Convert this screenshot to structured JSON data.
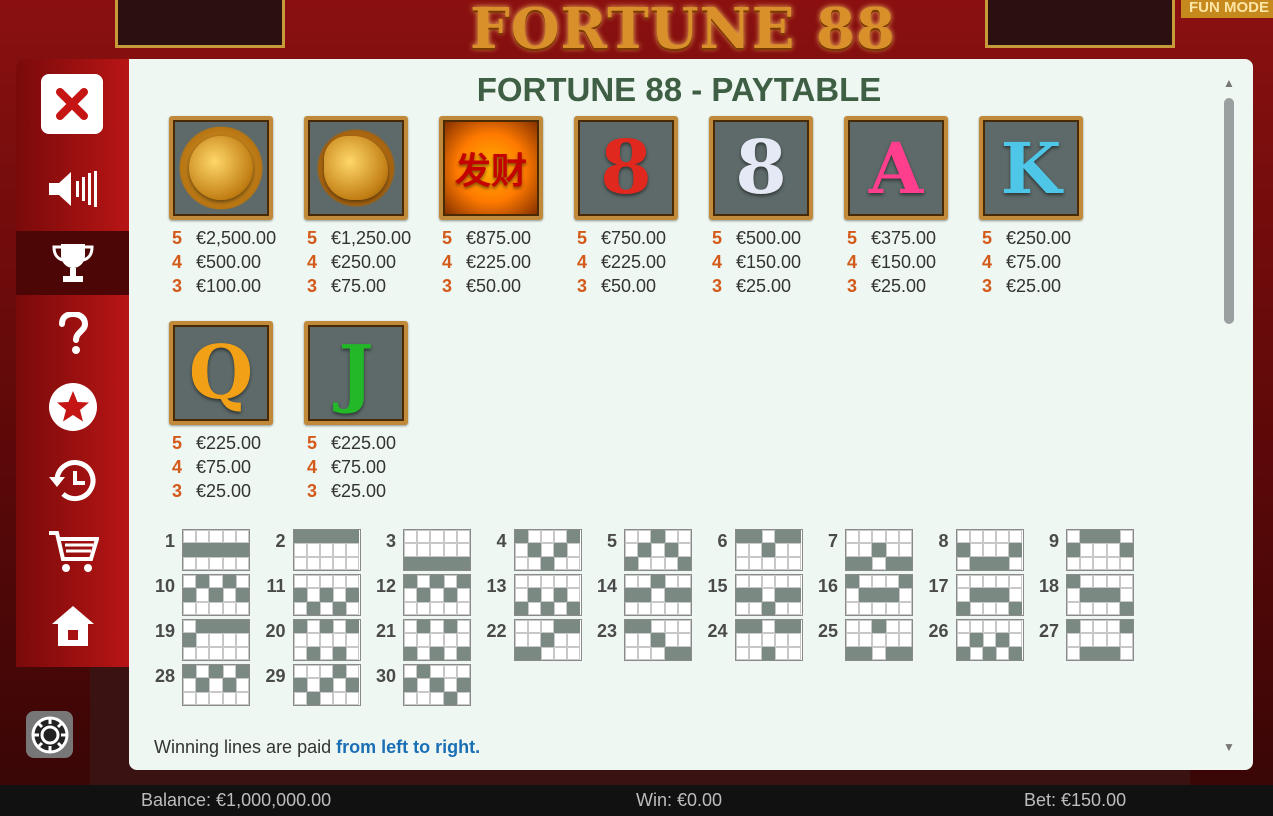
{
  "background": {
    "logo_text": "FORTUNE 88",
    "fun_mode": "FUN MODE"
  },
  "sidebar": {
    "icons": [
      "close-icon",
      "sound-icon",
      "trophy-icon",
      "help-icon",
      "star-icon",
      "history-icon",
      "cart-icon",
      "home-icon",
      "settings-chip-icon"
    ]
  },
  "paytable": {
    "title": "FORTUNE 88 - PAYTABLE",
    "symbols": [
      {
        "id": "lion",
        "pays": [
          {
            "m": "5",
            "v": "€2,500.00"
          },
          {
            "m": "4",
            "v": "€500.00"
          },
          {
            "m": "3",
            "v": "€100.00"
          }
        ]
      },
      {
        "id": "dragon",
        "pays": [
          {
            "m": "5",
            "v": "€1,250.00"
          },
          {
            "m": "4",
            "v": "€250.00"
          },
          {
            "m": "3",
            "v": "€75.00"
          }
        ]
      },
      {
        "id": "coin",
        "glyph": "发财",
        "pays": [
          {
            "m": "5",
            "v": "€875.00"
          },
          {
            "m": "4",
            "v": "€225.00"
          },
          {
            "m": "3",
            "v": "€50.00"
          }
        ]
      },
      {
        "id": "red-8",
        "glyph": "8",
        "pays": [
          {
            "m": "5",
            "v": "€750.00"
          },
          {
            "m": "4",
            "v": "€225.00"
          },
          {
            "m": "3",
            "v": "€50.00"
          }
        ]
      },
      {
        "id": "silver-8",
        "glyph": "8",
        "pays": [
          {
            "m": "5",
            "v": "€500.00"
          },
          {
            "m": "4",
            "v": "€150.00"
          },
          {
            "m": "3",
            "v": "€25.00"
          }
        ]
      },
      {
        "id": "a",
        "glyph": "A",
        "pays": [
          {
            "m": "5",
            "v": "€375.00"
          },
          {
            "m": "4",
            "v": "€150.00"
          },
          {
            "m": "3",
            "v": "€25.00"
          }
        ]
      },
      {
        "id": "k",
        "glyph": "K",
        "pays": [
          {
            "m": "5",
            "v": "€250.00"
          },
          {
            "m": "4",
            "v": "€75.00"
          },
          {
            "m": "3",
            "v": "€25.00"
          }
        ]
      },
      {
        "id": "q",
        "glyph": "Q",
        "pays": [
          {
            "m": "5",
            "v": "€225.00"
          },
          {
            "m": "4",
            "v": "€75.00"
          },
          {
            "m": "3",
            "v": "€25.00"
          }
        ]
      },
      {
        "id": "j",
        "glyph": "J",
        "pays": [
          {
            "m": "5",
            "v": "€225.00"
          },
          {
            "m": "4",
            "v": "€75.00"
          },
          {
            "m": "3",
            "v": "€25.00"
          }
        ]
      }
    ],
    "paylines": [
      {
        "n": "1",
        "rows": [
          1,
          1,
          1,
          1,
          1
        ]
      },
      {
        "n": "2",
        "rows": [
          0,
          0,
          0,
          0,
          0
        ]
      },
      {
        "n": "3",
        "rows": [
          2,
          2,
          2,
          2,
          2
        ]
      },
      {
        "n": "4",
        "rows": [
          0,
          1,
          2,
          1,
          0
        ]
      },
      {
        "n": "5",
        "rows": [
          2,
          1,
          0,
          1,
          2
        ]
      },
      {
        "n": "6",
        "rows": [
          0,
          0,
          1,
          0,
          0
        ]
      },
      {
        "n": "7",
        "rows": [
          2,
          2,
          1,
          2,
          2
        ]
      },
      {
        "n": "8",
        "rows": [
          1,
          2,
          2,
          2,
          1
        ]
      },
      {
        "n": "9",
        "rows": [
          1,
          0,
          0,
          0,
          1
        ]
      },
      {
        "n": "10",
        "rows": [
          1,
          0,
          1,
          0,
          1
        ]
      },
      {
        "n": "11",
        "rows": [
          1,
          2,
          1,
          2,
          1
        ]
      },
      {
        "n": "12",
        "rows": [
          0,
          1,
          0,
          1,
          0
        ]
      },
      {
        "n": "13",
        "rows": [
          2,
          1,
          2,
          1,
          2
        ]
      },
      {
        "n": "14",
        "rows": [
          1,
          1,
          0,
          1,
          1
        ]
      },
      {
        "n": "15",
        "rows": [
          1,
          1,
          2,
          1,
          1
        ]
      },
      {
        "n": "16",
        "rows": [
          0,
          1,
          1,
          1,
          0
        ]
      },
      {
        "n": "17",
        "rows": [
          2,
          1,
          1,
          1,
          2
        ]
      },
      {
        "n": "18",
        "rows": [
          0,
          1,
          1,
          1,
          2
        ]
      },
      {
        "n": "19",
        "rows": [
          1,
          0,
          0,
          0,
          0
        ]
      },
      {
        "n": "20",
        "rows": [
          0,
          2,
          0,
          2,
          0
        ]
      },
      {
        "n": "21",
        "rows": [
          2,
          0,
          2,
          0,
          2
        ]
      },
      {
        "n": "22",
        "rows": [
          2,
          2,
          1,
          0,
          0
        ]
      },
      {
        "n": "23",
        "rows": [
          0,
          0,
          1,
          2,
          2
        ]
      },
      {
        "n": "24",
        "rows": [
          0,
          0,
          2,
          0,
          0
        ]
      },
      {
        "n": "25",
        "rows": [
          2,
          2,
          0,
          2,
          2
        ]
      },
      {
        "n": "26",
        "rows": [
          2,
          1,
          2,
          1,
          2
        ]
      },
      {
        "n": "27",
        "rows": [
          0,
          2,
          2,
          2,
          0
        ]
      },
      {
        "n": "28",
        "rows": [
          0,
          1,
          0,
          1,
          0
        ]
      },
      {
        "n": "29",
        "rows": [
          1,
          2,
          1,
          0,
          1
        ]
      },
      {
        "n": "30",
        "rows": [
          1,
          0,
          1,
          2,
          1
        ]
      }
    ],
    "win_text_prefix": "Winning lines are paid ",
    "win_text_highlight": "from left to right."
  },
  "status": {
    "balance": "Balance: €1,000,000.00",
    "win": "Win: €0.00",
    "bet": "Bet: €150.00"
  },
  "colors": {
    "accent_red": "#b81515",
    "multiplier": "#d35a1a",
    "title_green": "#3f5f45",
    "link_blue": "#1a6fb5"
  }
}
